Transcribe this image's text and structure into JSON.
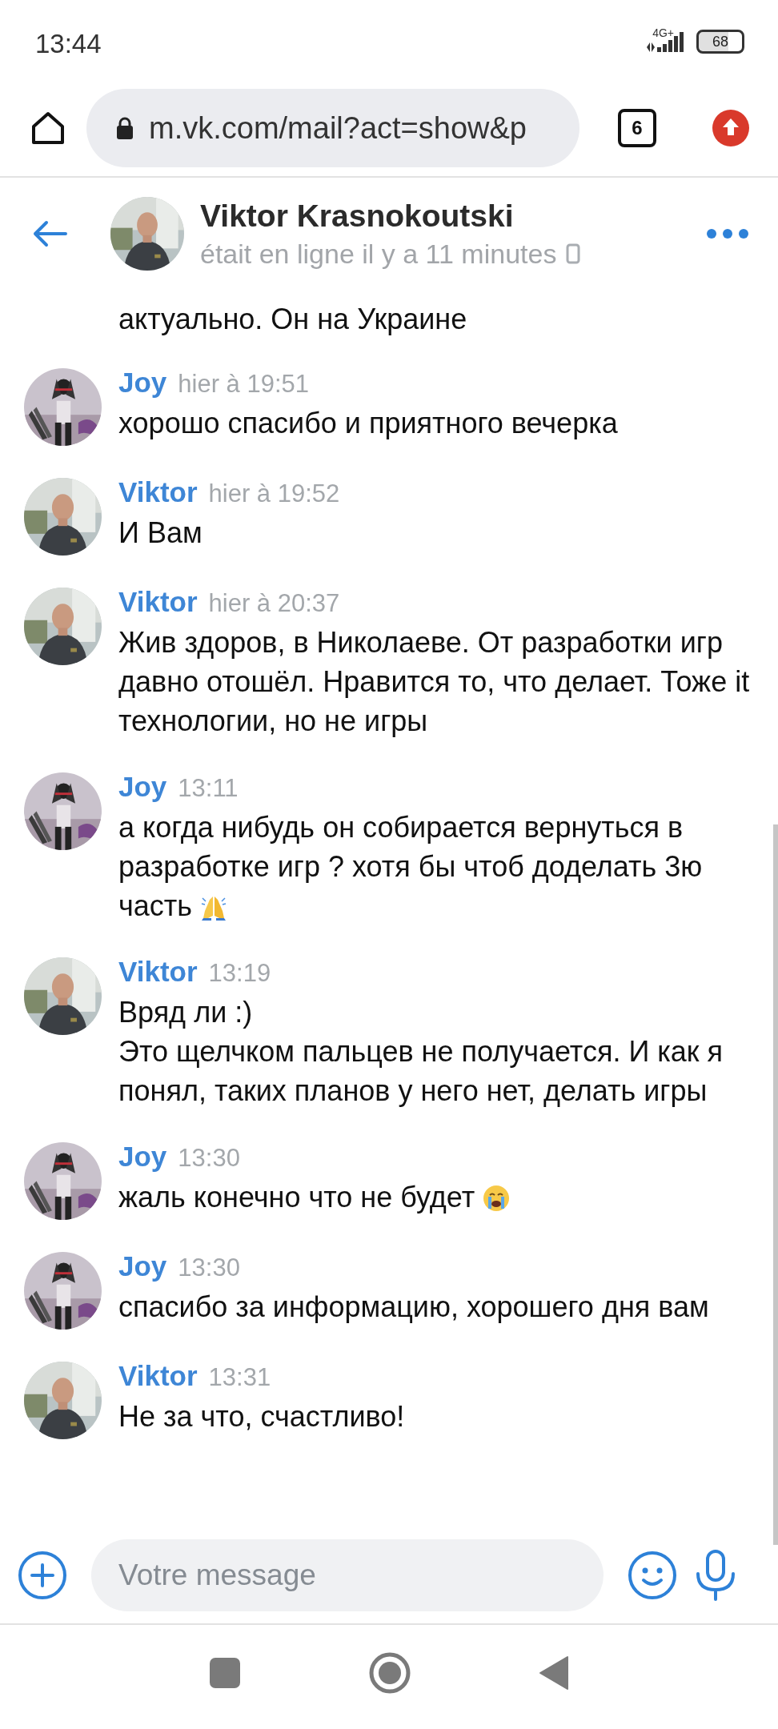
{
  "status_bar": {
    "time": "13:44",
    "network": "4G+",
    "battery": "68"
  },
  "browser": {
    "url": "m.vk.com/mail?act=show&p",
    "tab_count": "6"
  },
  "header": {
    "name": "Viktor Krasnokoutski",
    "status": "était en ligne il y a 11 minutes"
  },
  "fragment": "актуально. Он на Украине",
  "messages": [
    {
      "author": "Joy",
      "time": "hier à 19:51",
      "text": "хорошо спасибо и приятного вечерка",
      "kind": "joy"
    },
    {
      "author": "Viktor",
      "time": "hier à 19:52",
      "text": "И Вам",
      "kind": "viktor"
    },
    {
      "author": "Viktor",
      "time": "hier à 20:37",
      "text": "Жив здоров, в Николаеве. От разработки игр давно отошёл. Нравится то, что делает. Тоже it технологии, но не игры",
      "kind": "viktor"
    },
    {
      "author": "Joy",
      "time": "13:11",
      "text": "а когда нибудь он собирается вернуться в разработке игр ? хотя бы чтоб доделать 3ю часть",
      "kind": "joy",
      "emoji": {
        "kind": "prayer"
      }
    },
    {
      "author": "Viktor",
      "time": "13:19",
      "text": "Вряд ли :)\nЭто щелчком пальцев не получается. И как я понял, таких планов у него нет, делать игры",
      "kind": "viktor"
    },
    {
      "author": "Joy",
      "time": "13:30",
      "text": "жаль конечно что не будет",
      "kind": "joy",
      "emoji": {
        "kind": "crying"
      }
    },
    {
      "author": "Joy",
      "time": "13:30",
      "text": "спасибо за информацию, хорошего дня вам",
      "kind": "joy"
    },
    {
      "author": "Viktor",
      "time": "13:31",
      "text": "Не за что, счастливо!",
      "kind": "viktor"
    }
  ],
  "composer": {
    "placeholder": "Votre message"
  }
}
